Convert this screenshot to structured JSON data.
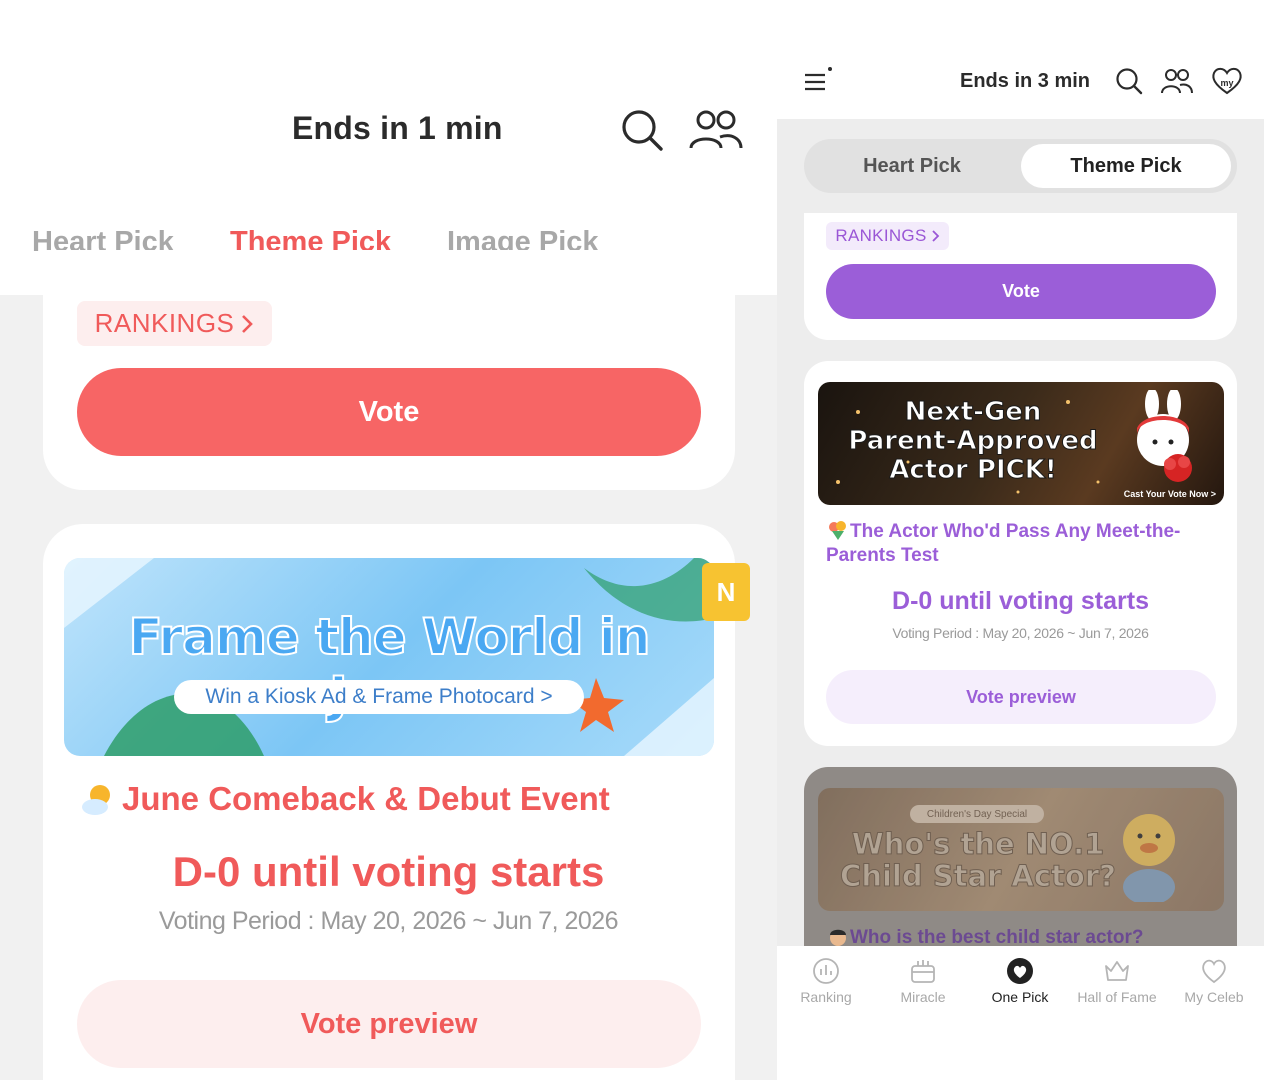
{
  "left": {
    "header": {
      "title": "Ends in 1 min"
    },
    "tabs": [
      {
        "label": "Heart Pick",
        "active": false
      },
      {
        "label": "Theme Pick",
        "active": true
      },
      {
        "label": "Image Pick",
        "active": false
      }
    ],
    "card1": {
      "rankings_label": "RANKINGS",
      "vote_label": "Vote"
    },
    "card2": {
      "banner_title": "Frame the World in June",
      "banner_subtitle": "Win a Kiosk Ad & Frame Photocard >",
      "new_badge": "N",
      "event_title": "June Comeback & Debut Event",
      "d_day": "D-0 until voting starts",
      "voting_period": "Voting Period : May 20, 2026 ~ Jun 7, 2026",
      "preview_label": "Vote preview"
    },
    "colors": {
      "accent": "#f05a5a",
      "accent_light": "#fdeeee"
    }
  },
  "right": {
    "header": {
      "title": "Ends in 3 min"
    },
    "segment": [
      {
        "label": "Heart Pick",
        "active": false
      },
      {
        "label": "Theme Pick",
        "active": true
      }
    ],
    "card1": {
      "rankings_label": "RANKINGS",
      "vote_label": "Vote"
    },
    "card2": {
      "banner_title_line1": "Next-Gen",
      "banner_title_line2": "Parent-Approved",
      "banner_title_line3": "Actor PICK!",
      "banner_cta": "Cast Your Vote Now >",
      "event_title": "The Actor Who'd Pass Any Meet-the-Parents Test",
      "d_day": "D-0 until voting starts",
      "voting_period": "Voting Period : May 20, 2026 ~ Jun 7, 2026",
      "preview_label": "Vote preview"
    },
    "card3": {
      "banner_pill": "Children's Day Special",
      "banner_title_line1": "Who's the NO.1",
      "banner_title_line2": "Child Star Actor?",
      "event_title": "Who is the best child star actor?"
    },
    "bottom_nav": [
      {
        "label": "Ranking",
        "icon": "ranking-icon",
        "active": false
      },
      {
        "label": "Miracle",
        "icon": "miracle-icon",
        "active": false
      },
      {
        "label": "One Pick",
        "icon": "one-pick-icon",
        "active": true
      },
      {
        "label": "Hall of Fame",
        "icon": "hall-of-fame-icon",
        "active": false
      },
      {
        "label": "My Celeb",
        "icon": "my-celeb-icon",
        "active": false
      }
    ],
    "colors": {
      "accent": "#9b5ed8",
      "accent_light": "#f5eefc"
    }
  }
}
